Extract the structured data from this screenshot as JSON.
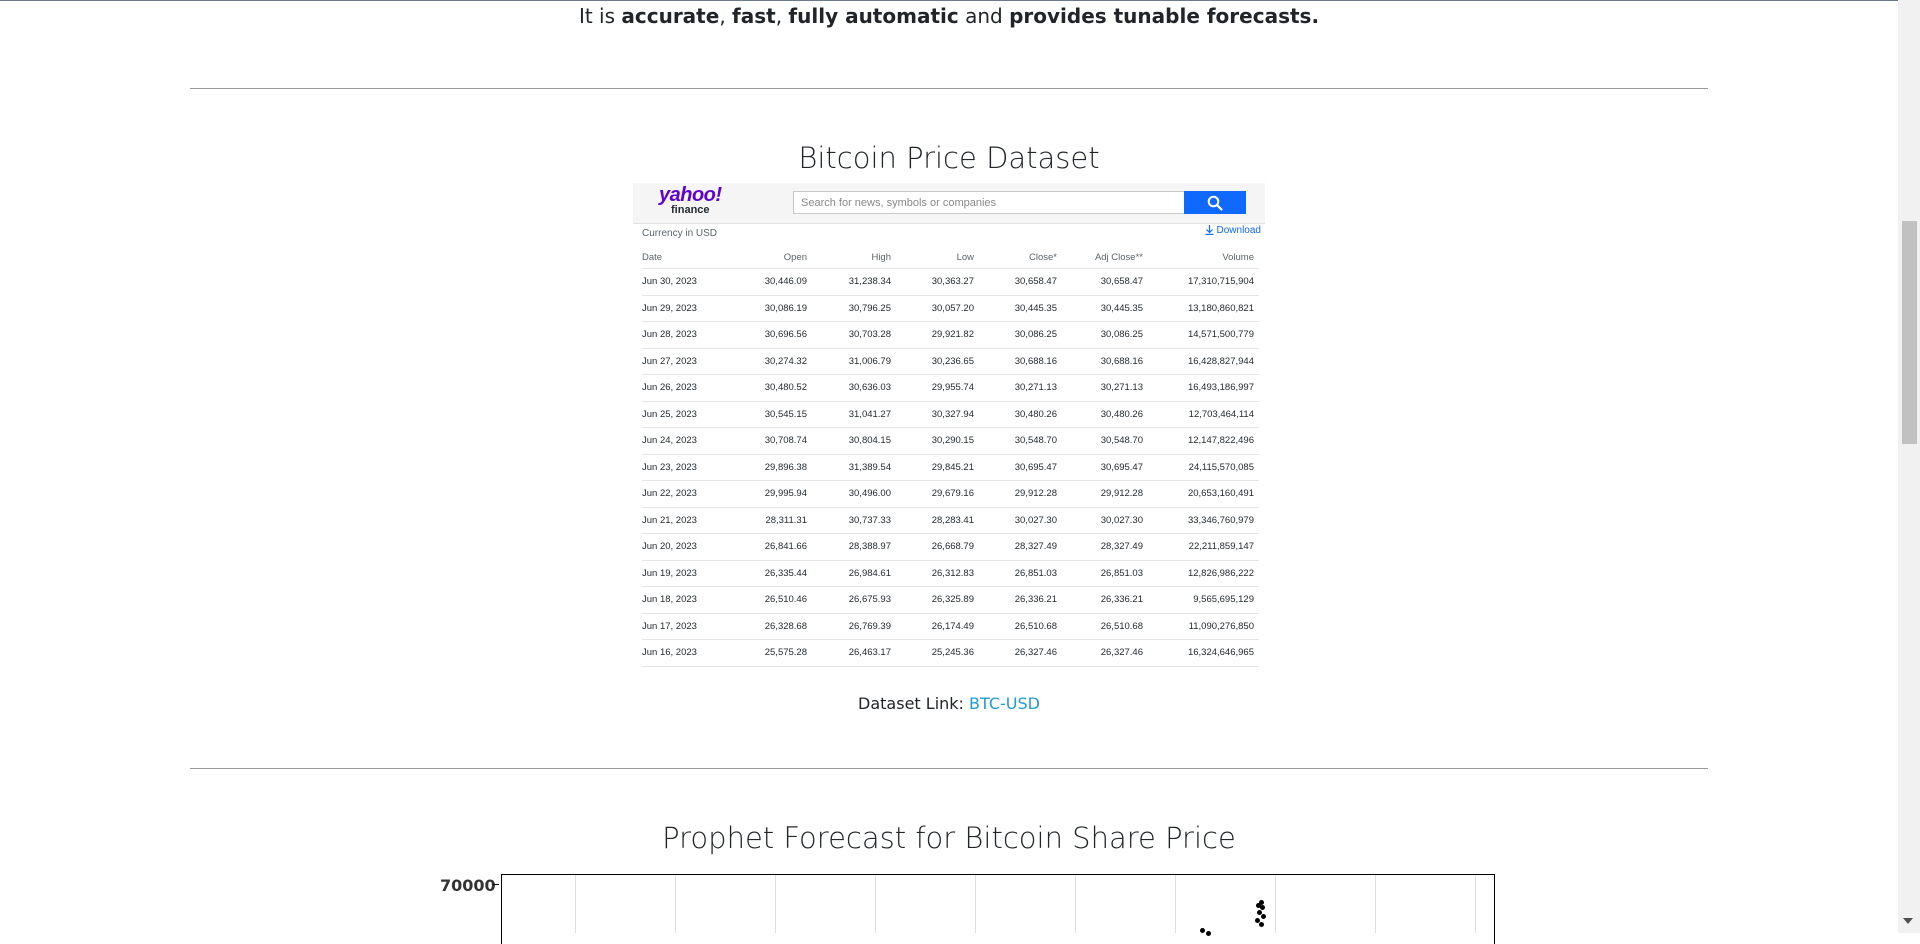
{
  "intro": {
    "prefix": "It is ",
    "b1": "accurate",
    "sep1": ", ",
    "b2": "fast",
    "sep2": ", ",
    "b3": "fully automatic",
    "mid": " and ",
    "b4": "provides tunable forecasts."
  },
  "dataset_section": {
    "title": "Bitcoin Price Dataset",
    "yahoo": {
      "logo_top": "yahoo!",
      "logo_bottom": "finance",
      "search_placeholder": "Search for news, symbols or companies",
      "currency": "Currency in USD",
      "download": "Download",
      "columns": [
        "Date",
        "Open",
        "High",
        "Low",
        "Close*",
        "Adj Close**",
        "Volume"
      ],
      "rows": [
        [
          "Jun 30, 2023",
          "30,446.09",
          "31,238.34",
          "30,363.27",
          "30,658.47",
          "30,658.47",
          "17,310,715,904"
        ],
        [
          "Jun 29, 2023",
          "30,086.19",
          "30,796.25",
          "30,057.20",
          "30,445.35",
          "30,445.35",
          "13,180,860,821"
        ],
        [
          "Jun 28, 2023",
          "30,696.56",
          "30,703.28",
          "29,921.82",
          "30,086.25",
          "30,086.25",
          "14,571,500,779"
        ],
        [
          "Jun 27, 2023",
          "30,274.32",
          "31,006.79",
          "30,236.65",
          "30,688.16",
          "30,688.16",
          "16,428,827,944"
        ],
        [
          "Jun 26, 2023",
          "30,480.52",
          "30,636.03",
          "29,955.74",
          "30,271.13",
          "30,271.13",
          "16,493,186,997"
        ],
        [
          "Jun 25, 2023",
          "30,545.15",
          "31,041.27",
          "30,327.94",
          "30,480.26",
          "30,480.26",
          "12,703,464,114"
        ],
        [
          "Jun 24, 2023",
          "30,708.74",
          "30,804.15",
          "30,290.15",
          "30,548.70",
          "30,548.70",
          "12,147,822,496"
        ],
        [
          "Jun 23, 2023",
          "29,896.38",
          "31,389.54",
          "29,845.21",
          "30,695.47",
          "30,695.47",
          "24,115,570,085"
        ],
        [
          "Jun 22, 2023",
          "29,995.94",
          "30,496.00",
          "29,679.16",
          "29,912.28",
          "29,912.28",
          "20,653,160,491"
        ],
        [
          "Jun 21, 2023",
          "28,311.31",
          "30,737.33",
          "28,283.41",
          "30,027.30",
          "30,027.30",
          "33,346,760,979"
        ],
        [
          "Jun 20, 2023",
          "26,841.66",
          "28,388.97",
          "26,668.79",
          "28,327.49",
          "28,327.49",
          "22,211,859,147"
        ],
        [
          "Jun 19, 2023",
          "26,335.44",
          "26,984.61",
          "26,312.83",
          "26,851.03",
          "26,851.03",
          "12,826,986,222"
        ],
        [
          "Jun 18, 2023",
          "26,510.46",
          "26,675.93",
          "26,325.89",
          "26,336.21",
          "26,336.21",
          "9,565,695,129"
        ],
        [
          "Jun 17, 2023",
          "26,328.68",
          "26,769.39",
          "26,174.49",
          "26,510.68",
          "26,510.68",
          "11,090,276,850"
        ],
        [
          "Jun 16, 2023",
          "25,575.28",
          "26,463.17",
          "25,245.36",
          "26,327.46",
          "26,327.46",
          "16,324,646,965"
        ]
      ]
    },
    "link_label": "Dataset Link: ",
    "link_text": "BTC-USD"
  },
  "forecast_section": {
    "title": "Prophet Forecast for Bitcoin Share Price",
    "y_tick_label": "70000"
  }
}
